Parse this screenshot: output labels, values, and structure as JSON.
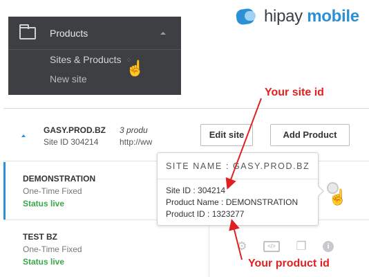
{
  "logo": {
    "text_plain": "hipay ",
    "text_bold": "mobile"
  },
  "menu": {
    "title": "Products",
    "items": [
      {
        "label": "Sites & Products"
      },
      {
        "label": "New site"
      }
    ]
  },
  "annotations": {
    "site_id_label": "Your site id",
    "product_id_label": "Your product id",
    "color": "#e02020"
  },
  "site": {
    "name": "GASY.PROD.BZ",
    "id_text": "Site ID 304214",
    "count_text": "3 produ",
    "url_text": "http://ww",
    "edit_label": "Edit site",
    "add_label": "Add Product"
  },
  "products": [
    {
      "name": "DEMONSTRATION",
      "type": "One-Time Fixed",
      "status": "Status live"
    },
    {
      "name": "TEST BZ",
      "type": "One-Time Fixed",
      "status": "Status live"
    }
  ],
  "tooltip": {
    "header": "SITE NAME : GASY.PROD.BZ",
    "site_id": "Site ID : 304214",
    "product_name": "Product Name : DEMONSTRATION",
    "product_id": "Product ID : 1323277"
  },
  "colors": {
    "accent": "#2d8fd6",
    "status_live": "#3aa84a",
    "menu_bg": "#3d3f43"
  },
  "icons": [
    "folder-icon",
    "gear-icon",
    "code-icon",
    "document-icon",
    "info-icon",
    "hand-cursor-icon"
  ]
}
